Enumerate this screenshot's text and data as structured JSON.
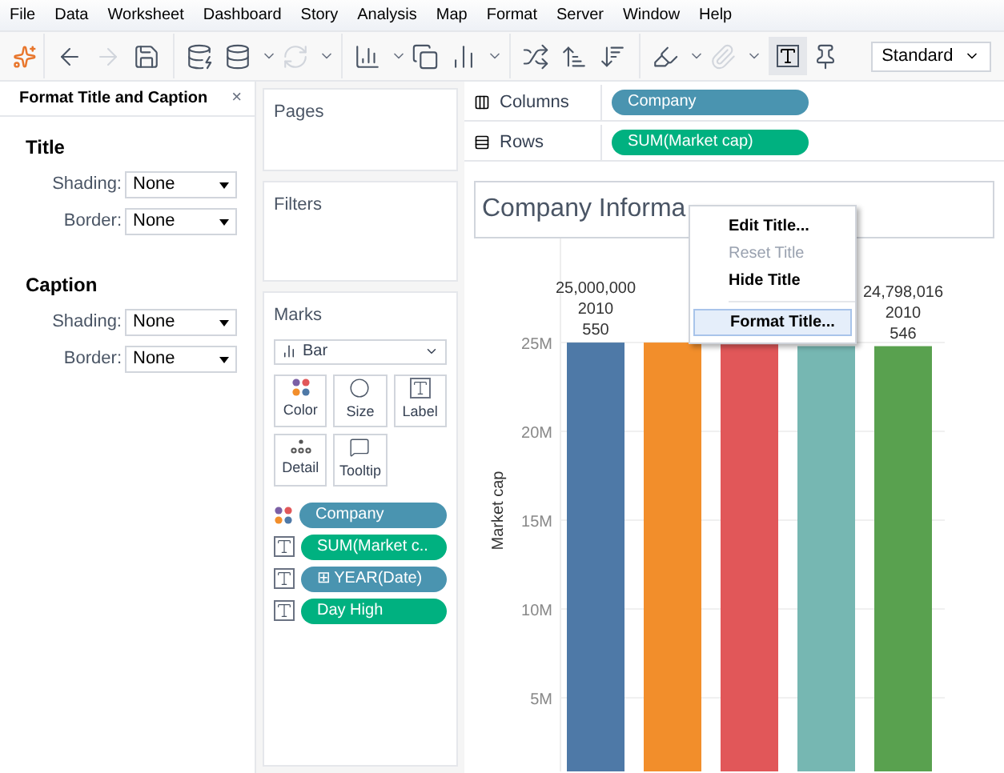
{
  "menu_bar": [
    "File",
    "Data",
    "Worksheet",
    "Dashboard",
    "Story",
    "Analysis",
    "Map",
    "Format",
    "Server",
    "Window",
    "Help"
  ],
  "toolbar": {
    "fit_dropdown": "Standard"
  },
  "format_panel": {
    "title": "Format Title and Caption",
    "close": "×",
    "sections": [
      {
        "heading": "Title",
        "fields": [
          {
            "label": "Shading:",
            "value": "None"
          },
          {
            "label": "Border:",
            "value": "None"
          }
        ]
      },
      {
        "heading": "Caption",
        "fields": [
          {
            "label": "Shading:",
            "value": "None"
          },
          {
            "label": "Border:",
            "value": "None"
          }
        ]
      }
    ]
  },
  "pages": {
    "title": "Pages"
  },
  "filters": {
    "title": "Filters"
  },
  "marks": {
    "title": "Marks",
    "mark_type": "Bar",
    "buttons": [
      {
        "kind": "color",
        "label": "Color"
      },
      {
        "kind": "size",
        "label": "Size"
      },
      {
        "kind": "label",
        "label": "Label"
      },
      {
        "kind": "detail",
        "label": "Detail"
      },
      {
        "kind": "tooltip",
        "label": "Tooltip"
      }
    ],
    "pills": [
      {
        "kind": "color",
        "label": "Company",
        "color": "#4a94b0"
      },
      {
        "kind": "label",
        "label": "SUM(Market c..",
        "color": "#00b180"
      },
      {
        "kind": "label",
        "label": "⊞ YEAR(Date)",
        "color": "#4a94b0"
      },
      {
        "kind": "label",
        "label": "Day High",
        "color": "#00b180"
      }
    ]
  },
  "shelves": [
    {
      "kind": "columns",
      "label": "Columns",
      "pill": "Company",
      "color": "#4a94b0"
    },
    {
      "kind": "rows",
      "label": "Rows",
      "pill": "SUM(Market cap)",
      "color": "#00b180"
    }
  ],
  "view": {
    "title": "Company Informa",
    "chart_data": {
      "type": "bar",
      "grid": true,
      "ylabel": "Market cap",
      "yticks": [
        {
          "value": 5000000,
          "label": "5M"
        },
        {
          "value": 10000000,
          "label": "10M"
        },
        {
          "value": 15000000,
          "label": "15M"
        },
        {
          "value": 20000000,
          "label": "20M"
        },
        {
          "value": 25000000,
          "label": "25M"
        }
      ],
      "ylim": [
        860000,
        30860000
      ],
      "series": [
        {
          "values": [
            25000000,
            25000000,
            24900000,
            24800000,
            24798016
          ],
          "colors": [
            "#4e79a7",
            "#f28e2b",
            "#e15759",
            "#76b7b2",
            "#59a14f"
          ],
          "value_labels": [
            "25,000,000\n2010\n550",
            null,
            null,
            null,
            "24,798,016\n2010\n546"
          ]
        }
      ]
    }
  },
  "context_menu": [
    {
      "label": "Edit Title...",
      "disabled": false,
      "selected": false
    },
    {
      "label": "Reset Title",
      "disabled": true,
      "selected": false
    },
    {
      "label": "Hide Title",
      "disabled": false,
      "selected": false
    },
    {
      "label": "Format Title...",
      "disabled": false,
      "selected": true
    }
  ]
}
